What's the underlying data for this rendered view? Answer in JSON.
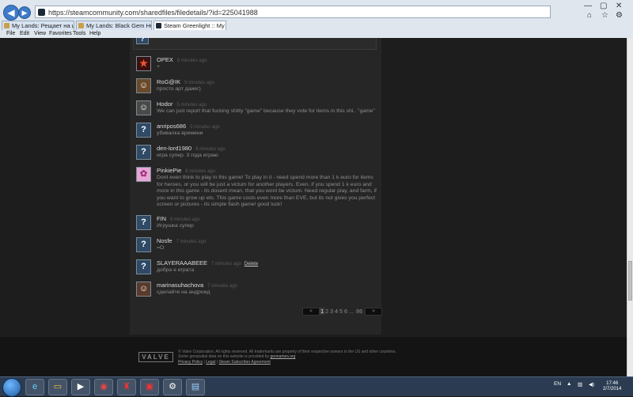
{
  "browser": {
    "url": "https://steamcommunity.com/sharedfiles/filedetails/?id=225041988",
    "tabs": [
      {
        "label": "My Lands: Рещает на цивили..."
      },
      {
        "label": "My Lands: Black Gem Hunting"
      },
      {
        "label": "Steam Greenlight :: My Lands"
      }
    ],
    "menu": [
      "File",
      "Edit",
      "View",
      "Favorites",
      "Tools",
      "Help"
    ],
    "back_label": "◀",
    "forward_label": "▶"
  },
  "comments": [
    {
      "author": "OPEX",
      "time": "5 minutes ago",
      "text": "+",
      "avatar": "star"
    },
    {
      "author": "RoG@IK",
      "time": "5 minutes ago",
      "text": "просто арт даиег)",
      "avatar": "face"
    },
    {
      "author": "Hodor",
      "time": "5 minutes ago",
      "text": "We can just report that fucking shitty \"game\" because they vote for items in this shi.. \"game\"",
      "avatar": "face"
    },
    {
      "author": "anripos686",
      "time": "5 minutes ago",
      "text": "убивалка времени",
      "avatar": "?"
    },
    {
      "author": "den-lord1980",
      "time": "6 minutes ago",
      "text": "игра супер. 3 года играю",
      "avatar": "?"
    },
    {
      "author": "PinkiePie",
      "time": "6 minutes ago",
      "text": "Dont even think to play in this game! To play in it - need spend more than 1 k euro for items for heroes, or you will be just a victum for another players. Even, if you spend 1 k euro and more in this game - its dosent mean, that you wont be victum. Need regular play, and farm, if you want to grow up ets. This game costs even more than EVE, but its not gives you perfect screen or pictures - its simple flash game! good luck!",
      "avatar": "pony"
    },
    {
      "author": "FIN",
      "time": "6 minutes ago",
      "text": "Игрушка супер",
      "avatar": "?"
    },
    {
      "author": "Nosfe",
      "time": "7 minutes ago",
      "text": "=O",
      "avatar": "?"
    },
    {
      "author": "SLAYERAAABEEE",
      "time": "7 minutes ago",
      "text": "добра е играта",
      "avatar": "?",
      "delete": "Delete"
    },
    {
      "author": "marinasuhachova",
      "time": "7 minutes ago",
      "text": "сделайте на андроид",
      "avatar": "face"
    }
  ],
  "pagination": {
    "prev": "<",
    "next": ">",
    "pages": [
      "1",
      "2",
      "3",
      "4",
      "5",
      "6",
      "...",
      "86"
    ],
    "current": "1"
  },
  "footer": {
    "logo": "VALVE",
    "line1": "© Valve Corporation. All rights reserved. All trademarks are property of their respective owners in the US and other countries.",
    "line2": "Some geospatial data on this website is provided by",
    "geonames": "geonames.org",
    "privacy": "Privacy Policy",
    "legal": "Legal",
    "ssa": "Steam Subscriber Agreement"
  },
  "taskbar": {
    "lang": "EN",
    "time": "17:46",
    "date": "2/7/2014"
  }
}
